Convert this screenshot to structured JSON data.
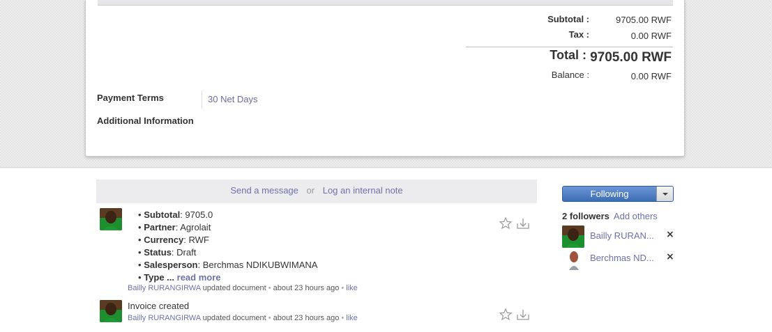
{
  "totals": {
    "subtotal_label": "Subtotal :",
    "subtotal_value": "9705.00 RWF",
    "tax_label": "Tax :",
    "tax_value": "0.00 RWF",
    "total_label": "Total :",
    "total_value": "9705.00 RWF",
    "balance_label": "Balance :",
    "balance_value": "0.00 RWF"
  },
  "fields": {
    "payment_terms_label": "Payment Terms",
    "payment_terms_value": "30 Net Days",
    "additional_info_label": "Additional Information"
  },
  "composer": {
    "send_message": "Send a message",
    "or": "or",
    "log_note": "Log an internal note"
  },
  "messages": [
    {
      "lines": [
        {
          "key": "Subtotal",
          "value": ": 9705.0"
        },
        {
          "key": "Partner",
          "value": ": Agrolait"
        },
        {
          "key": "Currency",
          "value": ": RWF"
        },
        {
          "key": "Status",
          "value": ": Draft"
        },
        {
          "key": "Salesperson",
          "value": ": Berchmas NDIKUBWIMANA"
        },
        {
          "key": "Type ...",
          "value": ""
        }
      ],
      "bullet": "•",
      "read_more": "read more",
      "author": "Bailly RURANGIRWA",
      "action": "updated document",
      "time": "about 23 hours ago",
      "like": "like"
    },
    {
      "body": "Invoice created",
      "author": "Bailly RURANGIRWA",
      "action": "updated document",
      "time": "about 23 hours ago",
      "like": "like"
    }
  ],
  "followers": {
    "button_label": "Following",
    "count_label": "2 followers",
    "add_label": "Add others",
    "list": [
      {
        "name": "Bailly RURAN...",
        "remove": "×"
      },
      {
        "name": "Berchmas ND...",
        "remove": "×"
      }
    ]
  },
  "colors": {
    "link": "#6c71a8",
    "follow_button": "#4a78bd"
  }
}
